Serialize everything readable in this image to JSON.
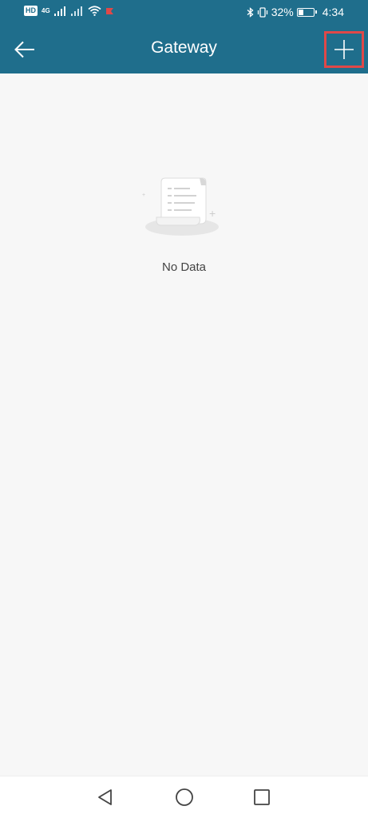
{
  "status_bar": {
    "hd_badge": "HD",
    "network_label": "4G",
    "battery_percent": "32%",
    "time": "4:34",
    "icons": [
      "hd-icon",
      "signal-icon",
      "wifi-icon",
      "notification-icon",
      "bluetooth-icon",
      "vibrate-icon",
      "battery-icon"
    ]
  },
  "header": {
    "title": "Gateway",
    "back_icon": "arrow-left-icon",
    "add_icon": "plus-icon",
    "background": "#1f6e8c",
    "highlight_color": "#e04848"
  },
  "empty_state": {
    "message": "No Data",
    "illustration_icon": "document-scroll-icon"
  },
  "nav_bar": {
    "icons": [
      "back-triangle-icon",
      "home-circle-icon",
      "recents-square-icon"
    ]
  }
}
